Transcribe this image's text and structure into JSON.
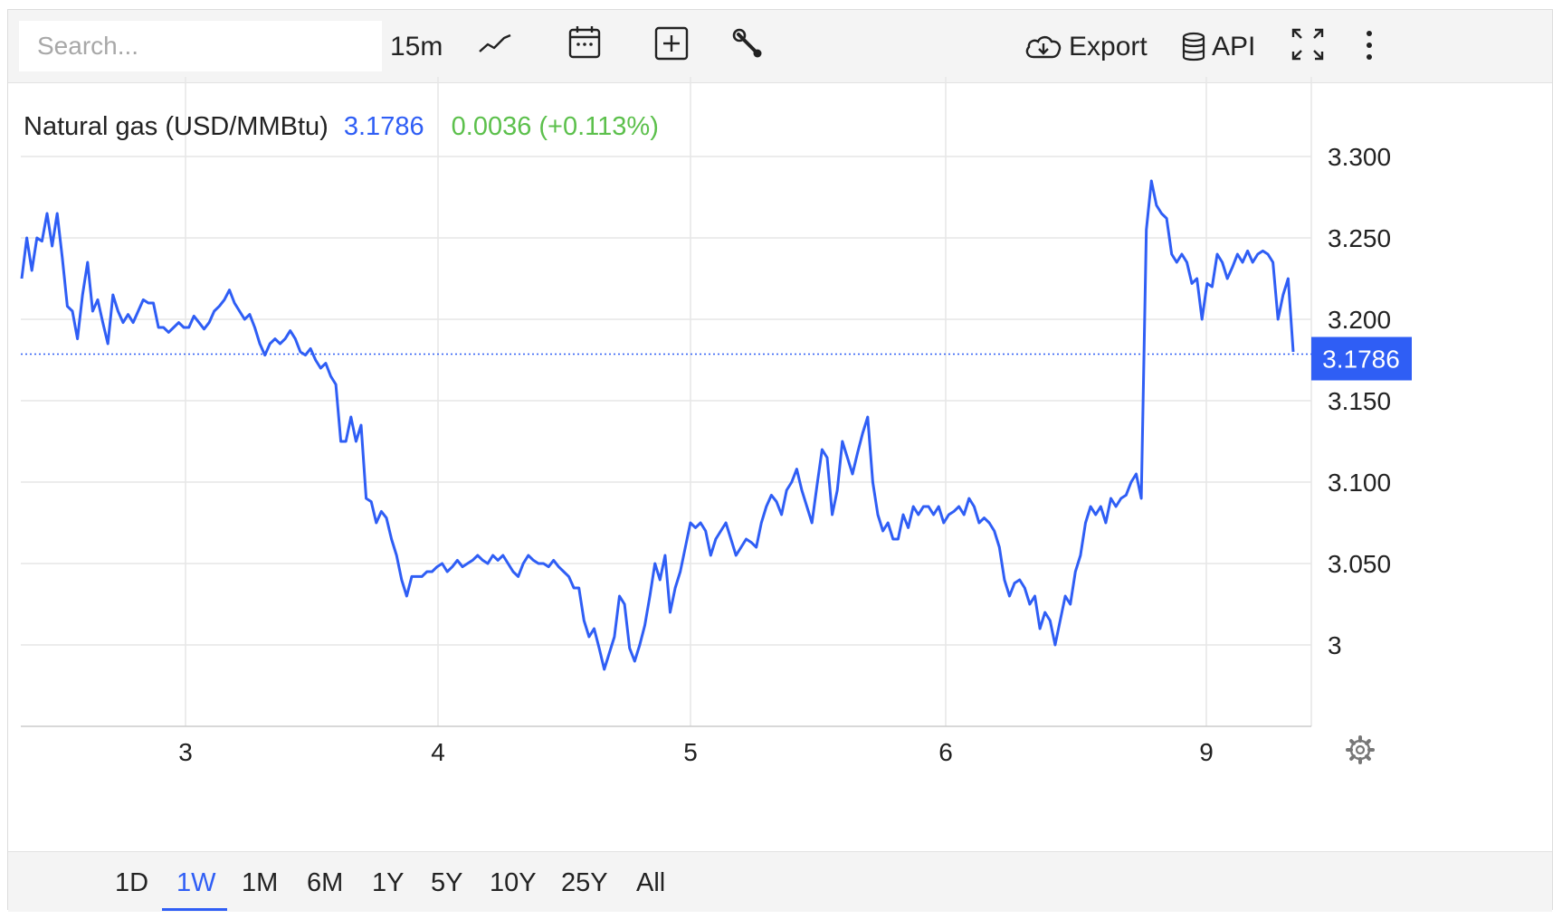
{
  "toolbar": {
    "search_placeholder": "Search...",
    "interval": "15m",
    "export_label": "Export",
    "api_label": "API",
    "icons": [
      "line-chart-icon",
      "calendar-icon",
      "plus-box-icon",
      "wrench-icon",
      "cloud-download-icon",
      "database-icon",
      "fullscreen-icon",
      "more-vertical-icon",
      "gear-icon"
    ]
  },
  "legend": {
    "name": "Natural gas (USD/MMBtu)",
    "price": "3.1786",
    "change": "0.0036 (+0.113%)"
  },
  "colors": {
    "line": "#2f5ef5",
    "positive": "#5cc04c",
    "badge": "#2f5ef5",
    "grid": "#e6e6e6"
  },
  "chart_data": {
    "type": "line",
    "series": [
      {
        "values": [
          3.225,
          3.25,
          3.23,
          3.25,
          3.248,
          3.265,
          3.245,
          3.265,
          3.238,
          3.208,
          3.205,
          3.188,
          3.215,
          3.235,
          3.205,
          3.212,
          3.198,
          3.185,
          3.215,
          3.205,
          3.198,
          3.203,
          3.198,
          3.205,
          3.212,
          3.21,
          3.21,
          3.195,
          3.195,
          3.192,
          3.195,
          3.198,
          3.195,
          3.195,
          3.202,
          3.198,
          3.194,
          3.198,
          3.205,
          3.208,
          3.212,
          3.218,
          3.21,
          3.205,
          3.2,
          3.203,
          3.195,
          3.185,
          3.178,
          3.185,
          3.188,
          3.185,
          3.188,
          3.193,
          3.188,
          3.18,
          3.178,
          3.182,
          3.175,
          3.17,
          3.173,
          3.165,
          3.16,
          3.125,
          3.125,
          3.14,
          3.125,
          3.135,
          3.09,
          3.088,
          3.075,
          3.082,
          3.078,
          3.065,
          3.055,
          3.04,
          3.03,
          3.042,
          3.042,
          3.042,
          3.045,
          3.045,
          3.048,
          3.05,
          3.045,
          3.048,
          3.052,
          3.048,
          3.05,
          3.052,
          3.055,
          3.052,
          3.05,
          3.055,
          3.052,
          3.055,
          3.05,
          3.045,
          3.042,
          3.05,
          3.055,
          3.052,
          3.05,
          3.05,
          3.048,
          3.052,
          3.048,
          3.045,
          3.042,
          3.035,
          3.035,
          3.015,
          3.005,
          3.01,
          2.998,
          2.985,
          2.995,
          3.005,
          3.03,
          3.025,
          2.998,
          2.99,
          3.0,
          3.012,
          3.03,
          3.05,
          3.04,
          3.055,
          3.02,
          3.035,
          3.045,
          3.06,
          3.075,
          3.072,
          3.075,
          3.07,
          3.055,
          3.065,
          3.07,
          3.075,
          3.065,
          3.055,
          3.06,
          3.065,
          3.063,
          3.06,
          3.075,
          3.085,
          3.092,
          3.088,
          3.08,
          3.095,
          3.1,
          3.108,
          3.095,
          3.085,
          3.075,
          3.098,
          3.12,
          3.115,
          3.08,
          3.095,
          3.125,
          3.115,
          3.105,
          3.118,
          3.13,
          3.14,
          3.1,
          3.08,
          3.07,
          3.075,
          3.065,
          3.065,
          3.08,
          3.072,
          3.085,
          3.08,
          3.085,
          3.085,
          3.08,
          3.085,
          3.075,
          3.08,
          3.082,
          3.085,
          3.08,
          3.09,
          3.085,
          3.075,
          3.078,
          3.075,
          3.07,
          3.06,
          3.04,
          3.03,
          3.038,
          3.04,
          3.035,
          3.025,
          3.03,
          3.01,
          3.02,
          3.015,
          3.0,
          3.015,
          3.03,
          3.025,
          3.045,
          3.055,
          3.075,
          3.085,
          3.08,
          3.085,
          3.075,
          3.09,
          3.085,
          3.09,
          3.092,
          3.1,
          3.105,
          3.09,
          3.255,
          3.285,
          3.27,
          3.265,
          3.262,
          3.24,
          3.235,
          3.24,
          3.235,
          3.222,
          3.225,
          3.2,
          3.222,
          3.22,
          3.24,
          3.235,
          3.225,
          3.232,
          3.24,
          3.235,
          3.242,
          3.235,
          3.24,
          3.242,
          3.24,
          3.235,
          3.2,
          3.215,
          3.225,
          3.18
        ],
        "x_range": [
          2.38,
          9.33
        ]
      }
    ],
    "x_ticks": [
      {
        "label": "3",
        "pos": 3.0
      },
      {
        "label": "4",
        "pos": 4.0
      },
      {
        "label": "5",
        "pos": 5.0
      },
      {
        "label": "6",
        "pos": 6.0
      },
      {
        "label": "9",
        "pos": 9.0
      }
    ],
    "y_ticks": [
      {
        "label": "3",
        "value": 3.0
      },
      {
        "label": "3.050",
        "value": 3.05
      },
      {
        "label": "3.100",
        "value": 3.1
      },
      {
        "label": "3.150",
        "value": 3.15
      },
      {
        "label": "3.200",
        "value": 3.2
      },
      {
        "label": "3.250",
        "value": 3.25
      },
      {
        "label": "3.300",
        "value": 3.3
      }
    ],
    "ylim": [
      2.95,
      3.35
    ],
    "last_value": 3.1786,
    "last_value_label": "3.1786",
    "grid": true,
    "xlabel": "",
    "ylabel": ""
  },
  "ranges": {
    "items": [
      "1D",
      "1W",
      "1M",
      "6M",
      "1Y",
      "5Y",
      "10Y",
      "25Y",
      "All"
    ],
    "active": "1W"
  }
}
